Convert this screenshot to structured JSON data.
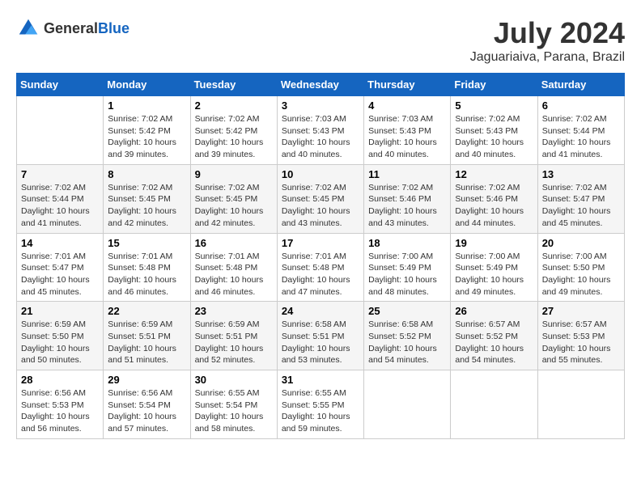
{
  "header": {
    "logo_general": "General",
    "logo_blue": "Blue",
    "month_year": "July 2024",
    "location": "Jaguariaiva, Parana, Brazil"
  },
  "weekdays": [
    "Sunday",
    "Monday",
    "Tuesday",
    "Wednesday",
    "Thursday",
    "Friday",
    "Saturday"
  ],
  "weeks": [
    [
      {
        "day": null,
        "info": null
      },
      {
        "day": "1",
        "sunrise": "7:02 AM",
        "sunset": "5:42 PM",
        "daylight": "10 hours and 39 minutes."
      },
      {
        "day": "2",
        "sunrise": "7:02 AM",
        "sunset": "5:42 PM",
        "daylight": "10 hours and 39 minutes."
      },
      {
        "day": "3",
        "sunrise": "7:03 AM",
        "sunset": "5:43 PM",
        "daylight": "10 hours and 40 minutes."
      },
      {
        "day": "4",
        "sunrise": "7:03 AM",
        "sunset": "5:43 PM",
        "daylight": "10 hours and 40 minutes."
      },
      {
        "day": "5",
        "sunrise": "7:02 AM",
        "sunset": "5:43 PM",
        "daylight": "10 hours and 40 minutes."
      },
      {
        "day": "6",
        "sunrise": "7:02 AM",
        "sunset": "5:44 PM",
        "daylight": "10 hours and 41 minutes."
      }
    ],
    [
      {
        "day": "7",
        "sunrise": "7:02 AM",
        "sunset": "5:44 PM",
        "daylight": "10 hours and 41 minutes."
      },
      {
        "day": "8",
        "sunrise": "7:02 AM",
        "sunset": "5:45 PM",
        "daylight": "10 hours and 42 minutes."
      },
      {
        "day": "9",
        "sunrise": "7:02 AM",
        "sunset": "5:45 PM",
        "daylight": "10 hours and 42 minutes."
      },
      {
        "day": "10",
        "sunrise": "7:02 AM",
        "sunset": "5:45 PM",
        "daylight": "10 hours and 43 minutes."
      },
      {
        "day": "11",
        "sunrise": "7:02 AM",
        "sunset": "5:46 PM",
        "daylight": "10 hours and 43 minutes."
      },
      {
        "day": "12",
        "sunrise": "7:02 AM",
        "sunset": "5:46 PM",
        "daylight": "10 hours and 44 minutes."
      },
      {
        "day": "13",
        "sunrise": "7:02 AM",
        "sunset": "5:47 PM",
        "daylight": "10 hours and 45 minutes."
      }
    ],
    [
      {
        "day": "14",
        "sunrise": "7:01 AM",
        "sunset": "5:47 PM",
        "daylight": "10 hours and 45 minutes."
      },
      {
        "day": "15",
        "sunrise": "7:01 AM",
        "sunset": "5:48 PM",
        "daylight": "10 hours and 46 minutes."
      },
      {
        "day": "16",
        "sunrise": "7:01 AM",
        "sunset": "5:48 PM",
        "daylight": "10 hours and 46 minutes."
      },
      {
        "day": "17",
        "sunrise": "7:01 AM",
        "sunset": "5:48 PM",
        "daylight": "10 hours and 47 minutes."
      },
      {
        "day": "18",
        "sunrise": "7:00 AM",
        "sunset": "5:49 PM",
        "daylight": "10 hours and 48 minutes."
      },
      {
        "day": "19",
        "sunrise": "7:00 AM",
        "sunset": "5:49 PM",
        "daylight": "10 hours and 49 minutes."
      },
      {
        "day": "20",
        "sunrise": "7:00 AM",
        "sunset": "5:50 PM",
        "daylight": "10 hours and 49 minutes."
      }
    ],
    [
      {
        "day": "21",
        "sunrise": "6:59 AM",
        "sunset": "5:50 PM",
        "daylight": "10 hours and 50 minutes."
      },
      {
        "day": "22",
        "sunrise": "6:59 AM",
        "sunset": "5:51 PM",
        "daylight": "10 hours and 51 minutes."
      },
      {
        "day": "23",
        "sunrise": "6:59 AM",
        "sunset": "5:51 PM",
        "daylight": "10 hours and 52 minutes."
      },
      {
        "day": "24",
        "sunrise": "6:58 AM",
        "sunset": "5:51 PM",
        "daylight": "10 hours and 53 minutes."
      },
      {
        "day": "25",
        "sunrise": "6:58 AM",
        "sunset": "5:52 PM",
        "daylight": "10 hours and 54 minutes."
      },
      {
        "day": "26",
        "sunrise": "6:57 AM",
        "sunset": "5:52 PM",
        "daylight": "10 hours and 54 minutes."
      },
      {
        "day": "27",
        "sunrise": "6:57 AM",
        "sunset": "5:53 PM",
        "daylight": "10 hours and 55 minutes."
      }
    ],
    [
      {
        "day": "28",
        "sunrise": "6:56 AM",
        "sunset": "5:53 PM",
        "daylight": "10 hours and 56 minutes."
      },
      {
        "day": "29",
        "sunrise": "6:56 AM",
        "sunset": "5:54 PM",
        "daylight": "10 hours and 57 minutes."
      },
      {
        "day": "30",
        "sunrise": "6:55 AM",
        "sunset": "5:54 PM",
        "daylight": "10 hours and 58 minutes."
      },
      {
        "day": "31",
        "sunrise": "6:55 AM",
        "sunset": "5:55 PM",
        "daylight": "10 hours and 59 minutes."
      },
      {
        "day": null,
        "info": null
      },
      {
        "day": null,
        "info": null
      },
      {
        "day": null,
        "info": null
      }
    ]
  ]
}
